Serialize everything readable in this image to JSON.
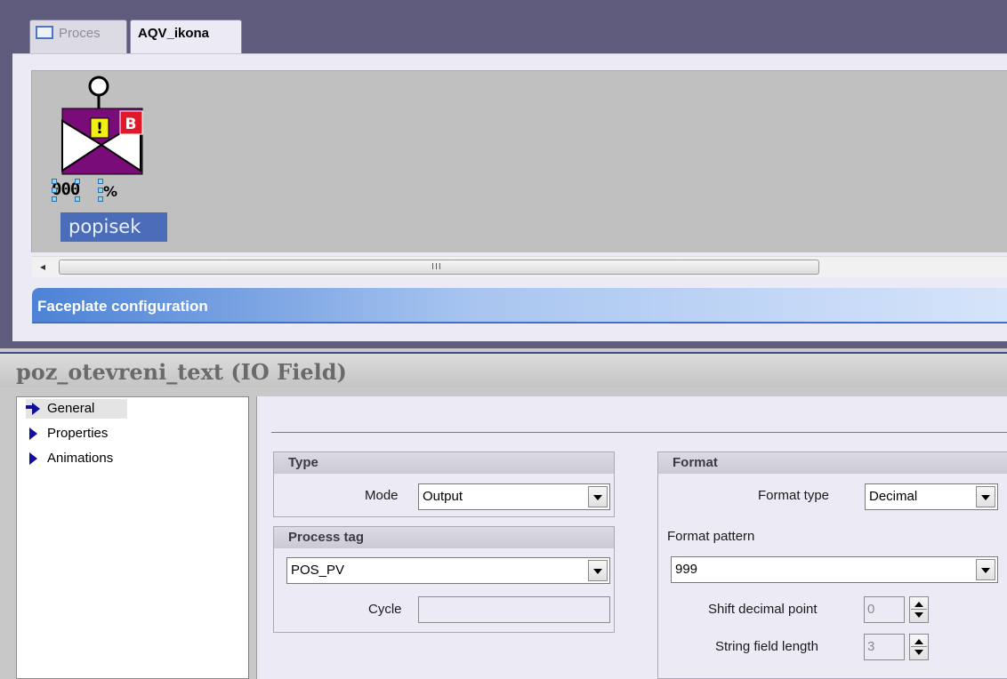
{
  "editor": {
    "tabs": [
      {
        "label": "Proces",
        "icon": "window-icon"
      },
      {
        "label": "AQV_ikona"
      }
    ],
    "canvas": {
      "io_field_text": "000",
      "percent_text": "%",
      "label_text": "popisek",
      "status_badges": {
        "warning": "!",
        "b": "B"
      }
    },
    "scrollbar": {
      "grip": "III",
      "left_arrow": "◂"
    },
    "faceplate_title": "Faceplate configuration"
  },
  "inspector": {
    "title": "poz_otevreni_text (IO Field)",
    "nav": [
      "General",
      "Properties",
      "Animations"
    ],
    "type_group": {
      "header": "Type",
      "mode_label": "Mode",
      "mode_value": "Output"
    },
    "process_tag_group": {
      "header": "Process tag",
      "tag_value": "POS_PV",
      "cycle_label": "Cycle",
      "cycle_value": ""
    },
    "format_group": {
      "header": "Format",
      "format_type_label": "Format type",
      "format_type_value": "Decimal",
      "format_pattern_label": "Format pattern",
      "format_pattern_value": "999",
      "shift_decimal_label": "Shift decimal point",
      "shift_decimal_value": "0",
      "string_length_label": "String field length",
      "string_length_value": "3"
    }
  },
  "colors": {
    "frame": "#5e5b7c",
    "canvas": "#c0c0c0",
    "valve_body": "#7a0c7a",
    "warning_badge": "#f3ef14",
    "b_badge": "#e0192a",
    "selection": "#4b6db9"
  }
}
